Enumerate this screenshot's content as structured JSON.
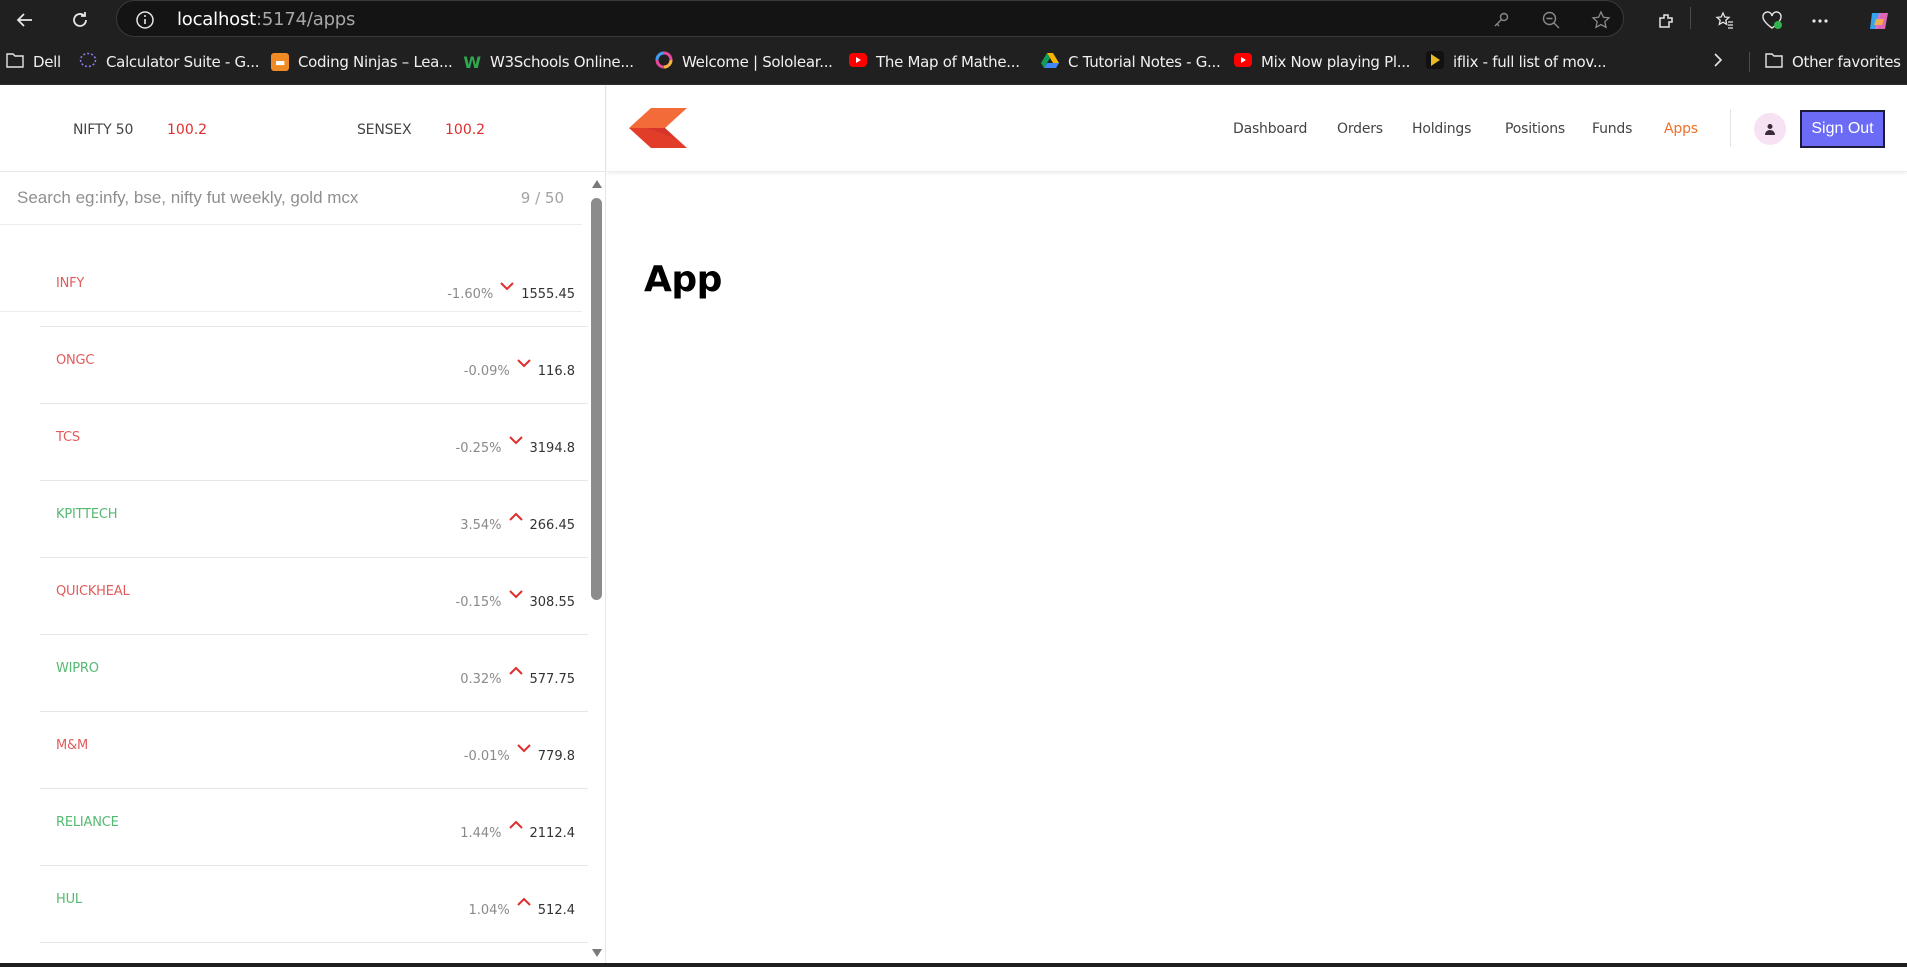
{
  "browser": {
    "url_host": "localhost",
    "url_path": ":5174/apps",
    "bookmarks": [
      {
        "label": "Dell",
        "icon": "folder-icon"
      },
      {
        "label": "Calculator Suite - G...",
        "icon": "geogebra-icon"
      },
      {
        "label": "Coding Ninjas – Lea...",
        "icon": "codingninjas-icon"
      },
      {
        "label": "W3Schools Online...",
        "icon": "w3schools-icon"
      },
      {
        "label": "Welcome | Sololear...",
        "icon": "sololearn-icon"
      },
      {
        "label": "The Map of Mathe...",
        "icon": "youtube-icon"
      },
      {
        "label": "C Tutorial Notes - G...",
        "icon": "google-drive-icon"
      },
      {
        "label": "Mix Now playing Pl...",
        "icon": "youtube-icon"
      },
      {
        "label": "iflix - full list of mov...",
        "icon": "iflix-icon"
      }
    ],
    "other_favorites": "Other favorites"
  },
  "indices": [
    {
      "name": "NIFTY 50",
      "value": "100.2"
    },
    {
      "name": "SENSEX",
      "value": "100.2"
    }
  ],
  "search": {
    "placeholder": "Search eg:infy, bse, nifty fut weekly, gold mcx",
    "count": "9 / 50"
  },
  "watchlist": [
    {
      "name": "INFY",
      "percent": "-1.60%",
      "price": "1555.45",
      "trend": "down"
    },
    {
      "name": "ONGC",
      "percent": "-0.09%",
      "price": "116.8",
      "trend": "down"
    },
    {
      "name": "TCS",
      "percent": "-0.25%",
      "price": "3194.8",
      "trend": "down"
    },
    {
      "name": "KPITTECH",
      "percent": "3.54%",
      "price": "266.45",
      "trend": "up"
    },
    {
      "name": "QUICKHEAL",
      "percent": "-0.15%",
      "price": "308.55",
      "trend": "down"
    },
    {
      "name": "WIPRO",
      "percent": "0.32%",
      "price": "577.75",
      "trend": "up"
    },
    {
      "name": "M&M",
      "percent": "-0.01%",
      "price": "779.8",
      "trend": "down"
    },
    {
      "name": "RELIANCE",
      "percent": "1.44%",
      "price": "2112.4",
      "trend": "up"
    },
    {
      "name": "HUL",
      "percent": "1.04%",
      "price": "512.4",
      "trend": "up"
    }
  ],
  "nav": {
    "items": [
      "Dashboard",
      "Orders",
      "Holdings",
      "Positions",
      "Funds",
      "Apps"
    ],
    "active": "Apps",
    "signout": "Sign Out"
  },
  "main": {
    "title": "App"
  },
  "colors": {
    "down": "#e25c5c",
    "up": "#55b971",
    "accent": "#f0712a",
    "signout_bg": "#6b6bf5",
    "index_value": "#e02d2d",
    "arrow": "#e02d2d"
  }
}
